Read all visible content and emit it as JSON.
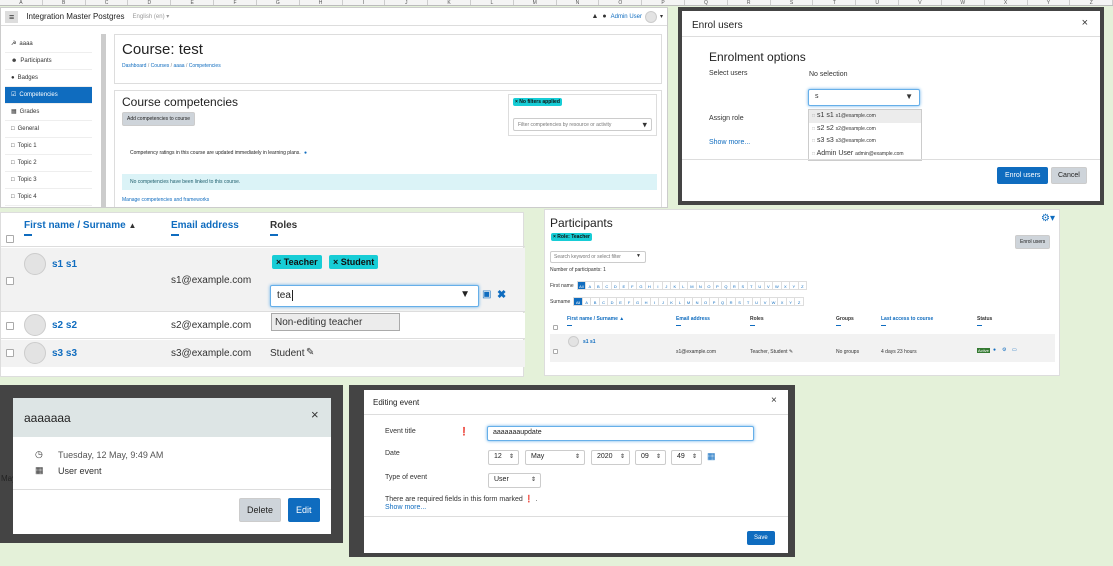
{
  "columns": [
    "A",
    "B",
    "C",
    "D",
    "E",
    "F",
    "G",
    "H",
    "I",
    "J",
    "K",
    "L",
    "M",
    "N",
    "O",
    "P",
    "Q",
    "R",
    "S",
    "T",
    "U",
    "V",
    "W",
    "X",
    "Y",
    "Z"
  ],
  "course": {
    "app_title": "Integration Master Postgres",
    "lang": "English (en) ▾",
    "user": "Admin User",
    "sidebar": [
      "aaaa",
      "Participants",
      "Badges",
      "Competencies",
      "Grades",
      "General",
      "Topic 1",
      "Topic 2",
      "Topic 3",
      "Topic 4"
    ],
    "title": "Course: test",
    "breadcrumb": [
      "Dashboard",
      "Courses",
      "aaaa",
      "Competencies"
    ],
    "section_title": "Course competencies",
    "add_button": "Add competencies to course",
    "filter_tag": "× No filters applied",
    "filter_placeholder": "Filter competencies by resource or activity",
    "info_text": "Competency ratings in this course are updated immediately in learning plans.",
    "alert": "No competencies have been linked to this course.",
    "manage_link": "Manage competencies and frameworks"
  },
  "enrol": {
    "title": "Enrol users",
    "close": "×",
    "heading": "Enrolment options",
    "select_label": "Select users",
    "no_selection": "No selection",
    "search_value": "s",
    "options": [
      {
        "name": "s1 s1",
        "email": "s1@example.com"
      },
      {
        "name": "s2 s2",
        "email": "s2@example.com"
      },
      {
        "name": "s3 s3",
        "email": "s3@example.com"
      },
      {
        "name": "Admin User",
        "email": "admin@example.com"
      }
    ],
    "assign_role": "Assign role",
    "show_more": "Show more...",
    "enrol_button": "Enrol users",
    "cancel_button": "Cancel"
  },
  "roles": {
    "headers": [
      "First name / Surname",
      "Email address",
      "Roles"
    ],
    "rows": [
      {
        "name": "s1 s1",
        "email": "s1@example.com"
      },
      {
        "name": "s2 s2",
        "email": "s2@example.com"
      },
      {
        "name": "s3 s3",
        "email": "s3@example.com",
        "role": "Student"
      }
    ],
    "tags": [
      "× Teacher",
      "× Student"
    ],
    "role_input": "tea",
    "suggestion": "Non-editing teacher"
  },
  "participants": {
    "title": "Participants",
    "filter_tag": "× Role: Teacher",
    "search_placeholder": "Search keyword or select filter",
    "count": "Number of participants: 1",
    "enrol_button": "Enrol users",
    "firstname_label": "First name",
    "surname_label": "Surname",
    "letters": [
      "All",
      "A",
      "B",
      "C",
      "D",
      "E",
      "F",
      "G",
      "H",
      "I",
      "J",
      "K",
      "L",
      "M",
      "N",
      "O",
      "P",
      "Q",
      "R",
      "S",
      "T",
      "U",
      "V",
      "W",
      "X",
      "Y",
      "Z"
    ],
    "headers": [
      "First name / Surname",
      "Email address",
      "Roles",
      "Groups",
      "Last access to course",
      "Status"
    ],
    "row": {
      "name": "s1 s1",
      "email": "s1@example.com",
      "roles": "Teacher, Student",
      "groups": "No groups",
      "last_access": "4 days 23 hours",
      "status": "Active"
    }
  },
  "event": {
    "title": "aaaaaaa",
    "close": "×",
    "when": "Tuesday, 12 May, 9:49 AM",
    "type": "User event",
    "delete": "Delete",
    "edit": "Edit",
    "bg_text": "May"
  },
  "editing": {
    "title": "Editing event",
    "close": "×",
    "title_label": "Event title",
    "title_value": "aaaaaaaupdate",
    "date_label": "Date",
    "day": "12",
    "month": "May",
    "year": "2020",
    "hour": "09",
    "minute": "49",
    "type_label": "Type of event",
    "type_value": "User",
    "required_text": "There are required fields in this form marked",
    "show_more": "Show more...",
    "save": "Save"
  }
}
